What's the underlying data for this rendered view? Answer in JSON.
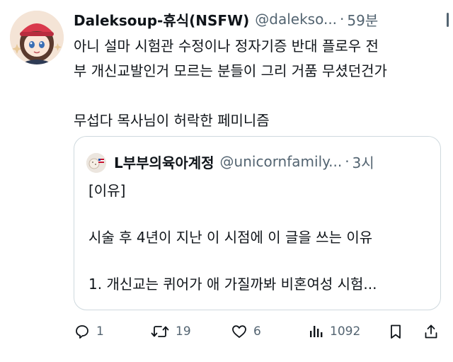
{
  "tweet": {
    "display_name": "Daleksoup-휴식(NSFW)",
    "handle": "@dalekso...",
    "separator": "·",
    "time": "59분",
    "lines": [
      "아니 설마 시험관 수정이나 정자기증 반대 플로우 전",
      "부 개신교발인거 모르는 분들이 그리 거품 무셨던건가",
      "무섭다 목사님이 허락한 페미니즘"
    ]
  },
  "quote": {
    "display_name": "L부부의육아계정",
    "handle": "@unicornfamily...",
    "separator": "·",
    "time": "3시",
    "lines": [
      "[이유]",
      "시술 후 4년이 지난 이 시점에 이 글을 쓰는 이유",
      "1. 개신교는 퀴어가 애 가질까봐 비혼여성 시험..."
    ]
  },
  "actions": {
    "reply_count": "1",
    "retweet_count": "19",
    "like_count": "6",
    "view_count": "1092"
  },
  "icons": {
    "reply": "reply-icon",
    "retweet": "retweet-icon",
    "like": "heart-icon",
    "views": "bar-chart-icon",
    "bookmark": "bookmark-icon",
    "share": "share-icon",
    "more": "more-vertical-icon"
  },
  "colors": {
    "text": "#0f1419",
    "muted": "#536471",
    "border": "#cfd9de"
  }
}
